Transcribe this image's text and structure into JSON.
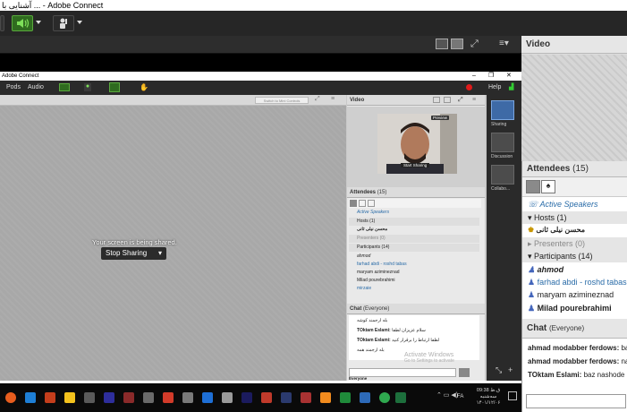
{
  "window": {
    "title": "آشنایی با ... - Adobe Connect"
  },
  "video_pod": {
    "title": "Video"
  },
  "attendees": {
    "title": "Attendees",
    "count": "(15)",
    "active_speakers": "Active Speakers",
    "hosts_label": "Hosts (1)",
    "host_name": "محسن نیلی ثانی",
    "presenters_label": "Presenters (0)",
    "participants_label": "Participants (14)",
    "participants": [
      "ahmod",
      "farhad abdi - roshd tabas",
      "maryam azimineznad",
      "Milad pourebrahimi"
    ]
  },
  "chat": {
    "title": "Chat",
    "scope": "(Everyone)",
    "messages": [
      {
        "sender": "ahmad modabber ferdows:",
        "text": "bale"
      },
      {
        "sender": "ahmad modabber ferdows:",
        "text": "na"
      },
      {
        "sender": "TOktam Eslami:",
        "text": "baz nashode"
      }
    ]
  },
  "inner": {
    "title": "Adobe Connect",
    "menu_pods": "Pods",
    "menu_audio": "Audio",
    "menu_help": "Help",
    "stage_hdr_btn": "Switch to Mini Controls",
    "sharing_text": "Your screen is being shared.",
    "stop_sharing": "Stop Sharing",
    "video_title": "Video",
    "presenter_badge": "Preview",
    "start_sharing": "Start Sharing",
    "attendees_title": "Attendees",
    "attendees_count": "(15)",
    "active_speakers": "Active Speakers",
    "hosts": "Hosts (1)",
    "host_name": "محسن نیلی ثانی",
    "presenters": "Presenters (0)",
    "participants": "Participants (14)",
    "participant_list": [
      "ahmod",
      "farhad abdi - roshd tabas",
      "maryam azimineznad",
      "Milad pourebrahimi",
      "mirzaie"
    ],
    "chat_title": "Chat",
    "chat_scope": "(Everyone)",
    "chat_lines": [
      {
        "sender": "",
        "text": "بله ارجمند کوشه"
      },
      {
        "sender": "TOktam Eslami:",
        "text": "سلام عزیزان لطفا"
      },
      {
        "sender": "TOktam Eslami:",
        "text": "لطفا ارتباط را برقرار کنید"
      },
      {
        "sender": "",
        "text": "بله ارجمند همه"
      }
    ],
    "chat_target": "Everyone",
    "activate_line1": "Activate Windows",
    "activate_line2": "Go to Settings to activate",
    "side_layouts": [
      "Sharing",
      "Discussion",
      "Collabo..."
    ]
  },
  "taskbar": {
    "time": "09:38 ق.ظ",
    "day": "سه‌شنبه",
    "date": "۱۴۰۱/۱۲/۰۶",
    "lang": "FA"
  }
}
